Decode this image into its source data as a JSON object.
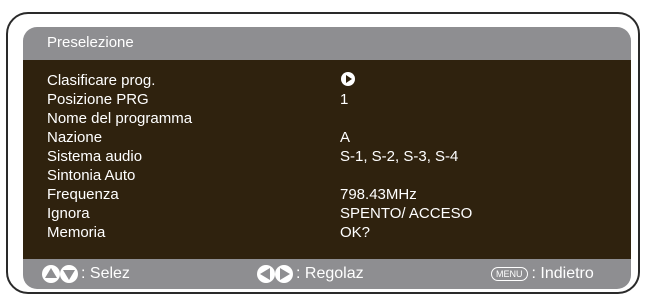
{
  "title": "Preselezione",
  "menu": [
    {
      "label": "Clasificare prog.",
      "value": "",
      "icon": "play-icon"
    },
    {
      "label": "Posizione PRG",
      "value": "1"
    },
    {
      "label": "Nome del programma",
      "value": ""
    },
    {
      "label": "Nazione",
      "value": "A"
    },
    {
      "label": "Sistema audio",
      "value": "S-1, S-2, S-3, S-4"
    },
    {
      "label": "Sintonia Auto",
      "value": ""
    },
    {
      "label": "Frequenza",
      "value": "798.43MHz"
    },
    {
      "label": "Ignora",
      "value": "SPENTO/ ACCESO"
    },
    {
      "label": "Memoria",
      "value": "OK?"
    }
  ],
  "footer": {
    "select_text": ": Selez",
    "adjust_text": ": Regolaz",
    "menu_key": "MENU",
    "back_text": ": Indietro"
  }
}
